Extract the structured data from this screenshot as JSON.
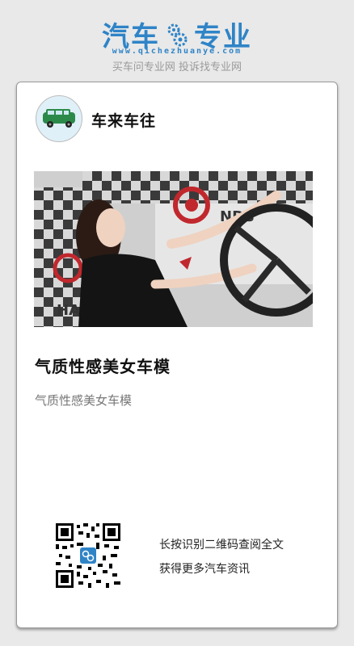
{
  "brand": {
    "logo_left": "汽车",
    "logo_right": "专业",
    "url": "www.qichezhuanye.com",
    "slogan": "买车问专业网 投诉找专业网",
    "color": "#2f84c7"
  },
  "article": {
    "author_name": "车来车往",
    "avatar_icon": "green-car-icon",
    "image_alt": "car-model-photo",
    "title": "气质性感美女车模",
    "subtitle": "气质性感美女车模"
  },
  "footer": {
    "qr_icon": "qr-code-icon",
    "cta_line1": "长按识别二维码查阅全文",
    "cta_line2": "获得更多汽车资讯"
  }
}
